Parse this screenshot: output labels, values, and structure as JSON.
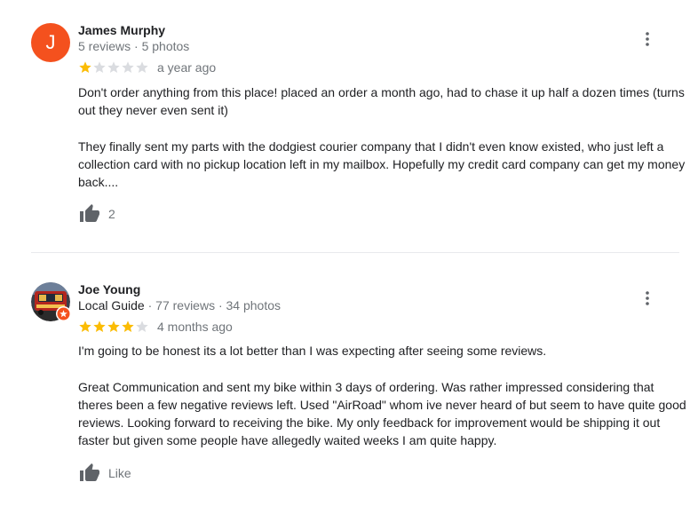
{
  "reviews": [
    {
      "avatar_letter": "J",
      "avatar_color": "#f4511e",
      "name": "James Murphy",
      "meta": "5 reviews · 5 photos",
      "rating": 1,
      "time": "a year ago",
      "paragraphs": [
        "Don't order anything from this place! placed an order a month ago, had to chase it up half a dozen times (turns out they never even sent it)",
        "They finally sent my parts with the dodgiest courier company that I didn't even know existed, who just left a collection card with no pickup location left in my mailbox. Hopefully my credit card company can get my money back...."
      ],
      "likes": "2",
      "more_icon": "more-vert-icon"
    },
    {
      "avatar_photo": true,
      "local_guide_badge_color": "#f4511e",
      "name": "Joe Young",
      "local_guide": "Local Guide",
      "meta_rest": " · 77 reviews · 34 photos",
      "rating": 4,
      "time": "4 months ago",
      "paragraphs": [
        "I'm going to be honest its a lot better than I was expecting after seeing some reviews.",
        "Great Communication and sent my bike within 3 days of ordering. Was rather impressed considering that theres been a few negative reviews left. Used \"AirRoad\" whom ive never heard of but seem to have quite good reviews. Looking forward to receiving the bike. My only feedback for improvement would be shipping it out faster but given some people have allegedly waited weeks I am quite happy."
      ],
      "likes": "Like",
      "more_icon": "more-vert-icon"
    }
  ],
  "colors": {
    "star_filled": "#fbbc04",
    "star_empty": "#dadce0",
    "icon_gray": "#5f6368",
    "secondary_text": "#70757a",
    "divider": "#e8eaed"
  }
}
